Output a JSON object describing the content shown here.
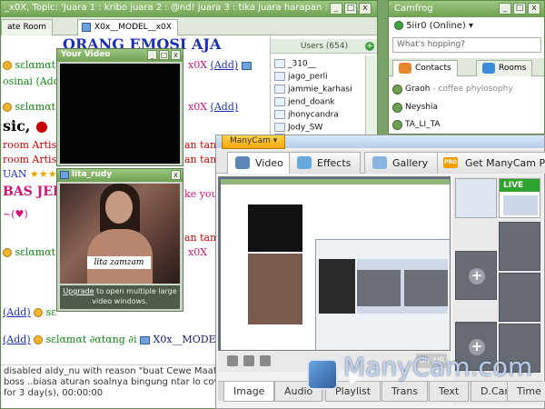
{
  "chat_window": {
    "title": "_x0X, Topic: 'Juara 1 : kribo juara 2 : @nd! juara 3 : tika juara harapan : [:p] (y...",
    "tabs": [
      "ate Room",
      "X0x__MODEL__x0X"
    ],
    "lines": [
      {
        "text": "ORANG EMOSI AJA",
        "style": "big blue"
      },
      {
        "prefix": "sεlαmαt",
        "text": "x0X",
        "link": "(Add)"
      },
      {
        "text": "osinai (Add)"
      },
      {
        "prefix": "sεlαmαt",
        "text": "x0X",
        "link": "(Add)"
      },
      {
        "text": "sic,"
      },
      {
        "text": "room Artis"
      },
      {
        "text": "room Artis"
      },
      {
        "text": "UAN"
      },
      {
        "text": "BAS JEE"
      },
      {
        "text": "~(♥)"
      },
      {
        "prefix": "sεlαmαt",
        "text": "x0X"
      },
      {
        "text": "(Add)",
        "prefix2": "sε"
      },
      {
        "text": "(Add)",
        "suffix": "sεlαmαt ∂αtαng ∂i",
        "end": "X0x__MODEL"
      },
      {
        "text": "ke you"
      },
      {
        "text": "an tang"
      },
      {
        "text": "an tan"
      },
      {
        "text": "an tang"
      }
    ],
    "status_lines": [
      "disabled aldy_nu with reason \"buat Cewe Maaf",
      "boss ..biasa aturan soalnya bingung ntar lo cow",
      "for 3 day(s), 00:00:00"
    ]
  },
  "users_panel": {
    "header": "Users (654)",
    "users": [
      "_310__",
      "jago_perli",
      "jammie_karhasi",
      "jend_doank",
      "jhonycandra",
      "Jody_SW",
      "..."
    ]
  },
  "your_video": {
    "title": "Your Video"
  },
  "lita_video": {
    "title": "lita_rudy",
    "caption": "lita zamzam",
    "upgrade_link": "Upgrade",
    "upgrade_text": "to open multiple large video windows."
  },
  "camfrog": {
    "title": "Camfrog",
    "user": "5iir0 (Online)",
    "hopping_placeholder": "What's hopping?",
    "tabs": [
      "Contacts",
      "Rooms"
    ],
    "contacts": [
      {
        "name": "Graoh",
        "status": "- coffee phylosophy"
      },
      {
        "name": "Neyshia",
        "status": ""
      },
      {
        "name": "TA_LI_TA",
        "status": ""
      }
    ]
  },
  "manycam": {
    "menu": "ManyCam",
    "tabs": [
      "Video",
      "Effects",
      "Gallery",
      "Get ManyCam Pro"
    ],
    "pro_badge": "PRO",
    "live_badge": "LIVE",
    "on_air": "ON AIR",
    "bottom_tabs": [
      "Image",
      "Audio",
      "Playlist",
      "Trans",
      "Text",
      "D.Cam",
      "Time"
    ],
    "watermark": "ManyCam.com",
    "plus": "+"
  },
  "colors": {
    "frame_green": "#6fa052",
    "chat_pink": "#d6107a",
    "chat_blue": "#1a2fb8",
    "manycam_orange": "#f4a60a"
  }
}
